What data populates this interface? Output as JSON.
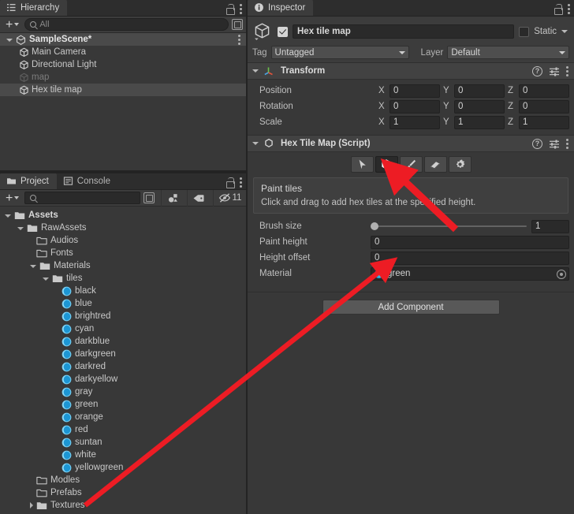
{
  "hierarchy": {
    "tab_label": "Hierarchy",
    "tab_icon": "hierarchy-list-icon",
    "toolbar": {
      "add_label": "+",
      "search_placeholder": "All",
      "search_value": ""
    },
    "rows": [
      {
        "label": "SampleScene*",
        "depth": 0,
        "icon": "scene-icon",
        "expanded": true,
        "selected": false,
        "dim": false,
        "is_scene": true
      },
      {
        "label": "Main Camera",
        "depth": 1,
        "icon": "gameobject-icon",
        "expanded": null,
        "selected": false,
        "dim": false,
        "is_scene": false
      },
      {
        "label": "Directional Light",
        "depth": 1,
        "icon": "gameobject-icon",
        "expanded": null,
        "selected": false,
        "dim": false,
        "is_scene": false
      },
      {
        "label": "map",
        "depth": 1,
        "icon": "gameobject-icon",
        "expanded": null,
        "selected": false,
        "dim": true,
        "is_scene": false
      },
      {
        "label": "Hex tile map",
        "depth": 1,
        "icon": "gameobject-icon",
        "expanded": null,
        "selected": true,
        "dim": false,
        "is_scene": false
      }
    ]
  },
  "project": {
    "tabs": [
      {
        "label": "Project",
        "icon": "folder-icon",
        "active": true
      },
      {
        "label": "Console",
        "icon": "console-icon",
        "active": false
      }
    ],
    "toolbar": {
      "add_label": "+",
      "search_placeholder": "",
      "search_value": "",
      "hidden_count": "11",
      "icons": [
        "open-in-new-icon",
        "shape-filter-icon",
        "label-filter-icon",
        "hidden-eye-icon"
      ]
    },
    "rows": [
      {
        "label": "Assets",
        "depth": 0,
        "type": "folder",
        "expanded": true,
        "bold": true
      },
      {
        "label": "RawAssets",
        "depth": 1,
        "type": "folder",
        "expanded": true,
        "bold": false
      },
      {
        "label": "Audios",
        "depth": 2,
        "type": "folder-empty",
        "expanded": null,
        "bold": false
      },
      {
        "label": "Fonts",
        "depth": 2,
        "type": "folder-empty",
        "expanded": null,
        "bold": false
      },
      {
        "label": "Materials",
        "depth": 2,
        "type": "folder",
        "expanded": true,
        "bold": false
      },
      {
        "label": "tiles",
        "depth": 3,
        "type": "folder",
        "expanded": true,
        "bold": false
      },
      {
        "label": "black",
        "depth": 4,
        "type": "material",
        "expanded": null,
        "bold": false
      },
      {
        "label": "blue",
        "depth": 4,
        "type": "material",
        "expanded": null,
        "bold": false
      },
      {
        "label": "brightred",
        "depth": 4,
        "type": "material",
        "expanded": null,
        "bold": false
      },
      {
        "label": "cyan",
        "depth": 4,
        "type": "material",
        "expanded": null,
        "bold": false
      },
      {
        "label": "darkblue",
        "depth": 4,
        "type": "material",
        "expanded": null,
        "bold": false
      },
      {
        "label": "darkgreen",
        "depth": 4,
        "type": "material",
        "expanded": null,
        "bold": false
      },
      {
        "label": "darkred",
        "depth": 4,
        "type": "material",
        "expanded": null,
        "bold": false
      },
      {
        "label": "darkyellow",
        "depth": 4,
        "type": "material",
        "expanded": null,
        "bold": false
      },
      {
        "label": "gray",
        "depth": 4,
        "type": "material",
        "expanded": null,
        "bold": false
      },
      {
        "label": "green",
        "depth": 4,
        "type": "material",
        "expanded": null,
        "bold": false
      },
      {
        "label": "orange",
        "depth": 4,
        "type": "material",
        "expanded": null,
        "bold": false
      },
      {
        "label": "red",
        "depth": 4,
        "type": "material",
        "expanded": null,
        "bold": false
      },
      {
        "label": "suntan",
        "depth": 4,
        "type": "material",
        "expanded": null,
        "bold": false
      },
      {
        "label": "white",
        "depth": 4,
        "type": "material",
        "expanded": null,
        "bold": false
      },
      {
        "label": "yellowgreen",
        "depth": 4,
        "type": "material",
        "expanded": null,
        "bold": false
      },
      {
        "label": "Modles",
        "depth": 2,
        "type": "folder-empty",
        "expanded": null,
        "bold": false
      },
      {
        "label": "Prefabs",
        "depth": 2,
        "type": "folder-empty",
        "expanded": null,
        "bold": false
      },
      {
        "label": "Textures",
        "depth": 2,
        "type": "folder",
        "expanded": false,
        "bold": false
      }
    ]
  },
  "inspector": {
    "tab_label": "Inspector",
    "tab_icon": "info-icon",
    "object": {
      "enabled": true,
      "name": "Hex tile map",
      "static_label": "Static",
      "static_checked": false,
      "tag_label": "Tag",
      "tag_value": "Untagged",
      "layer_label": "Layer",
      "layer_value": "Default"
    },
    "transform": {
      "title": "Transform",
      "expanded": true,
      "rows": [
        {
          "label": "Position",
          "x": "0",
          "y": "0",
          "z": "0"
        },
        {
          "label": "Rotation",
          "x": "0",
          "y": "0",
          "z": "0"
        },
        {
          "label": "Scale",
          "x": "1",
          "y": "1",
          "z": "1"
        }
      ],
      "axes": [
        "X",
        "Y",
        "Z"
      ]
    },
    "script_component": {
      "title": "Hex Tile Map (Script)",
      "expanded": true,
      "tools": [
        {
          "name": "select-tool",
          "icon": "cursor-arrow-icon",
          "active": false
        },
        {
          "name": "paint-tiles-tool",
          "icon": "hexagon-plus-icon",
          "active": true
        },
        {
          "name": "brush-tool",
          "icon": "paintbrush-icon",
          "active": false
        },
        {
          "name": "eraser-tool",
          "icon": "eraser-icon",
          "active": false
        },
        {
          "name": "settings-tool",
          "icon": "gear-icon",
          "active": false
        }
      ],
      "help": {
        "title": "Paint tiles",
        "description": "Click and drag to add hex tiles at the specified height."
      },
      "fields": [
        {
          "label": "Brush size",
          "type": "slider",
          "value": "1",
          "slider_fraction": 0.0
        },
        {
          "label": "Paint height",
          "type": "number",
          "value": "0"
        },
        {
          "label": "Height offset",
          "type": "number",
          "value": "0"
        },
        {
          "label": "Material",
          "type": "object",
          "value": "green"
        }
      ]
    },
    "add_component_label": "Add Component"
  },
  "annotations": {
    "arrow_color": "#ed1c24",
    "arrows": [
      {
        "name": "arrow-to-paint-tool",
        "from": [
          578,
          290
        ],
        "to": [
          500,
          218
        ]
      },
      {
        "name": "arrow-to-material-field",
        "from": [
          110,
          640
        ],
        "to": [
          488,
          340
        ]
      }
    ]
  }
}
